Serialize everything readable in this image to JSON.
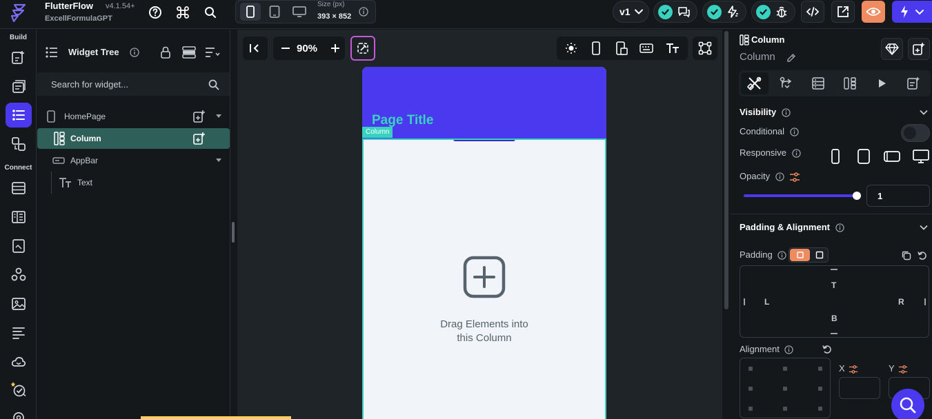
{
  "app": {
    "name": "FlutterFlow",
    "version": "v4.1.54+",
    "project": "ExcellFormulaGPT"
  },
  "topbar": {
    "size_label": "Size (px)",
    "size_value": "393 × 852",
    "version_select": "v1"
  },
  "rail": {
    "build_label": "Build",
    "connect_label": "Connect"
  },
  "tree": {
    "title": "Widget Tree",
    "search_placeholder": "Search for widget...",
    "items": [
      {
        "label": "HomePage"
      },
      {
        "label": "Column"
      },
      {
        "label": "AppBar"
      },
      {
        "label": "Text"
      }
    ]
  },
  "canvas": {
    "zoom": "90%",
    "page_title": "Page Title",
    "column_tag": "Column",
    "drop_line1": "Drag Elements into",
    "drop_line2": "this Column"
  },
  "props": {
    "title": "Column",
    "subtitle": "Column",
    "visibility": {
      "title": "Visibility",
      "conditional": "Conditional",
      "responsive": "Responsive",
      "opacity": "Opacity",
      "opacity_value": "1"
    },
    "padding": {
      "title": "Padding & Alignment",
      "label": "Padding",
      "top": "T",
      "left": "L",
      "right": "R",
      "bottom": "B",
      "alignment": "Alignment",
      "x": "X",
      "y": "Y"
    }
  },
  "colors": {
    "primary": "#4b39ef",
    "secondary": "#39d2c0",
    "tertiary": "#ee8b60"
  }
}
